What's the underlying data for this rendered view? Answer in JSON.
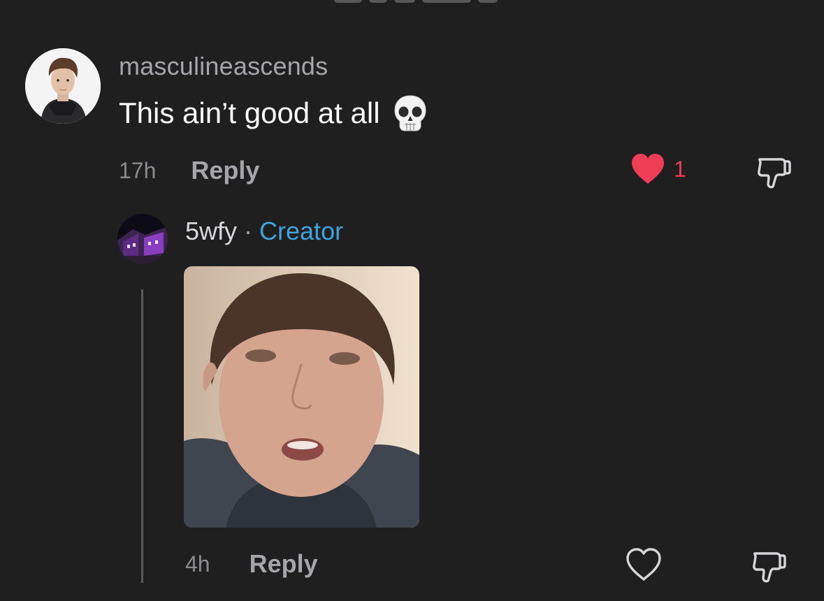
{
  "comment": {
    "username": "masculineascends",
    "text": "This ain’t good at all",
    "emoji": "skull-emoji",
    "time": "17h",
    "reply_label": "Reply",
    "like_count": "1",
    "liked": true
  },
  "reply": {
    "username": "5wfy",
    "separator": "·",
    "badge": "Creator",
    "media": "video-reply-thumbnail",
    "time": "4h",
    "reply_label": "Reply",
    "liked": false
  },
  "colors": {
    "background": "#1f1f20",
    "like_red": "#ee3d55",
    "creator_blue": "#3fa3dc",
    "muted_text": "#a6a6a8"
  }
}
